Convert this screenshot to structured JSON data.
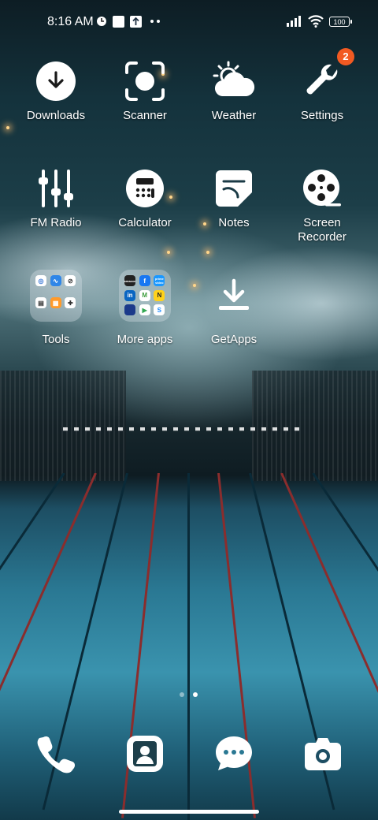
{
  "status_bar": {
    "time": "8:16 AM",
    "battery": "100"
  },
  "home": {
    "row1": [
      {
        "label": "Downloads",
        "icon": "download-icon"
      },
      {
        "label": "Scanner",
        "icon": "scanner-icon"
      },
      {
        "label": "Weather",
        "icon": "weather-icon"
      },
      {
        "label": "Settings",
        "icon": "wrench-icon",
        "badge": "2"
      }
    ],
    "row2": [
      {
        "label": "FM Radio",
        "icon": "equalizer-icon"
      },
      {
        "label": "Calculator",
        "icon": "calculator-icon"
      },
      {
        "label": "Notes",
        "icon": "notes-icon"
      },
      {
        "label": "Screen\nRecorder",
        "icon": "film-reel-icon"
      }
    ],
    "row3": [
      {
        "label": "Tools",
        "icon": "folder-icon"
      },
      {
        "label": "More apps",
        "icon": "folder-icon"
      },
      {
        "label": "GetApps",
        "icon": "download-tray-icon"
      }
    ],
    "more_apps_mini": [
      "amazon",
      "f",
      "prime video",
      "in",
      "M",
      "N",
      "",
      "▶",
      "S"
    ]
  },
  "page_indicator": {
    "pages": 2,
    "current": 2
  },
  "dock": [
    "phone-icon",
    "contacts-icon",
    "messages-icon",
    "camera-icon"
  ],
  "colors": {
    "badge": "#f25a22",
    "icon": "#ffffff"
  }
}
